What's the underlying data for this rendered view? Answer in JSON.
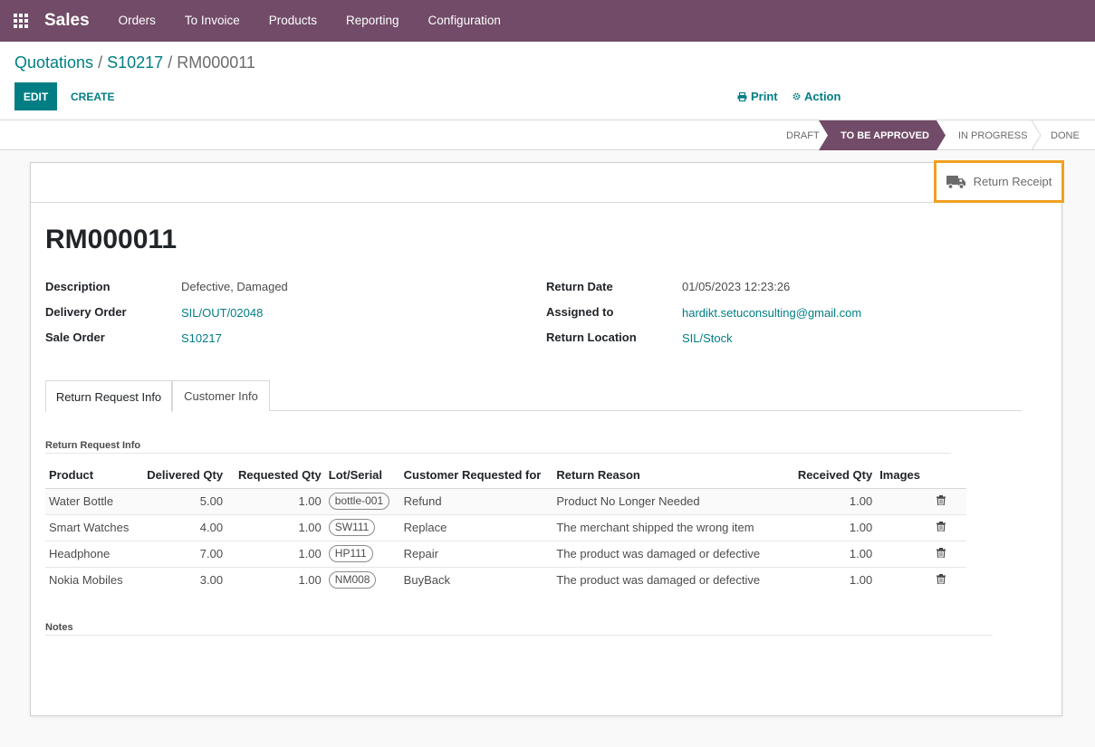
{
  "navbar": {
    "brand": "Sales",
    "menu": [
      "Orders",
      "To Invoice",
      "Products",
      "Reporting",
      "Configuration"
    ]
  },
  "breadcrumb": {
    "items": [
      "Quotations",
      "S10217",
      "RM000011"
    ],
    "separator": "/"
  },
  "toolbar": {
    "edit_label": "EDIT",
    "create_label": "CREATE",
    "print_label": "Print",
    "action_label": "Action"
  },
  "status": {
    "stages": [
      "DRAFT",
      "TO BE APPROVED",
      "IN PROGRESS",
      "DONE"
    ],
    "active": "TO BE APPROVED"
  },
  "smart_button": {
    "label": "Return Receipt",
    "icon": "truck-icon"
  },
  "record": {
    "name": "RM000011",
    "left_fields": [
      {
        "label": "Description",
        "value": "Defective, Damaged"
      },
      {
        "label": "Delivery Order",
        "value": "SIL/OUT/02048"
      },
      {
        "label": "Sale Order",
        "value": "S10217"
      }
    ],
    "right_fields": [
      {
        "label": "Return Date",
        "value": "01/05/2023 12:23:26"
      },
      {
        "label": "Assigned to",
        "value": "hardikt.setuconsulting@gmail.com"
      },
      {
        "label": "Return Location",
        "value": "SIL/Stock"
      }
    ]
  },
  "tabs": [
    "Return Request Info",
    "Customer Info"
  ],
  "section": {
    "title": "Return Request Info",
    "notes_title": "Notes"
  },
  "table": {
    "columns": [
      "Product",
      "Delivered Qty",
      "Requested Qty",
      "Lot/Serial",
      "Customer Requested for",
      "Return Reason",
      "Received Qty",
      "Images"
    ],
    "rows": [
      {
        "product": "Water Bottle",
        "delivered": "5.00",
        "requested": "1.00",
        "lot": "bottle-001",
        "request": "Refund",
        "reason": "Product No Longer Needed",
        "received": "1.00"
      },
      {
        "product": "Smart Watches",
        "delivered": "4.00",
        "requested": "1.00",
        "lot": "SW111",
        "request": "Replace",
        "reason": "The merchant shipped the wrong item",
        "received": "1.00"
      },
      {
        "product": "Headphone",
        "delivered": "7.00",
        "requested": "1.00",
        "lot": "HP111",
        "request": "Repair",
        "reason": "The product was damaged or defective",
        "received": "1.00"
      },
      {
        "product": "Nokia Mobiles",
        "delivered": "3.00",
        "requested": "1.00",
        "lot": "NM008",
        "request": "BuyBack",
        "reason": "The product was damaged or defective",
        "received": "1.00"
      }
    ]
  },
  "colors": {
    "brand": "#714B67",
    "accent": "#017e84",
    "highlight": "#f0a020"
  }
}
